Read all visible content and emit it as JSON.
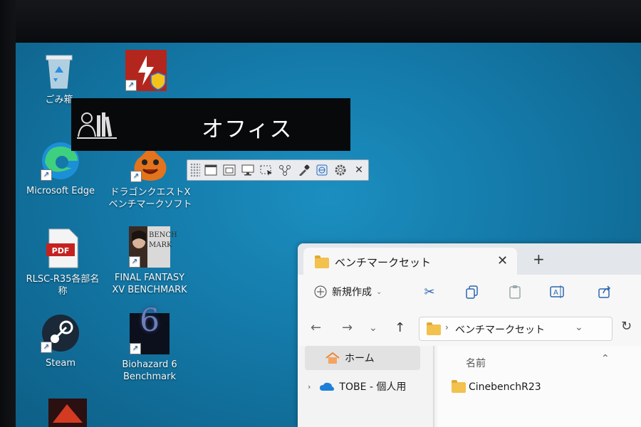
{
  "desktop": {
    "icons": [
      {
        "name": "recycle-bin",
        "label": "ごみ箱"
      },
      {
        "name": "app-shield",
        "label": ""
      },
      {
        "name": "microsoft-edge",
        "label": "Microsoft Edge"
      },
      {
        "name": "dragon-quest",
        "label": "ドラゴンクエストX\nベンチマークソフト"
      },
      {
        "name": "pdf-file",
        "label": "RLSC-R35各部名\n称"
      },
      {
        "name": "ffxv",
        "label": "FINAL FANTASY\nXV BENCHMARK"
      },
      {
        "name": "steam",
        "label": "Steam"
      },
      {
        "name": "biohazard",
        "label": "Biohazard 6\nBenchmark"
      }
    ],
    "pdf_text": "PDF",
    "ffxv_art_text": "BENCH\nMARK",
    "biohazard_art_text": "6"
  },
  "launcher": {
    "title": "オフィス"
  },
  "toolbar": {
    "buttons": [
      "window-icon",
      "maximize-icon",
      "monitor-icon",
      "region-select-icon",
      "share-icon",
      "eyedropper-icon",
      "web-icon",
      "settings-icon"
    ],
    "close": "✕"
  },
  "explorer": {
    "tab_title": "ベンチマークセット",
    "tab_close": "✕",
    "new_tab": "+",
    "new_button": "新規作成",
    "address": "ベンチマークセット",
    "sidebar": [
      {
        "label": "ホーム"
      },
      {
        "label": "TOBE - 個人用"
      }
    ],
    "column_name": "名前",
    "files": [
      {
        "name": "CinebenchR23"
      }
    ]
  },
  "colors": {
    "desktop": "#1479a8",
    "explorer_bg": "#f3f3f3",
    "accent": "#2b67b0"
  }
}
